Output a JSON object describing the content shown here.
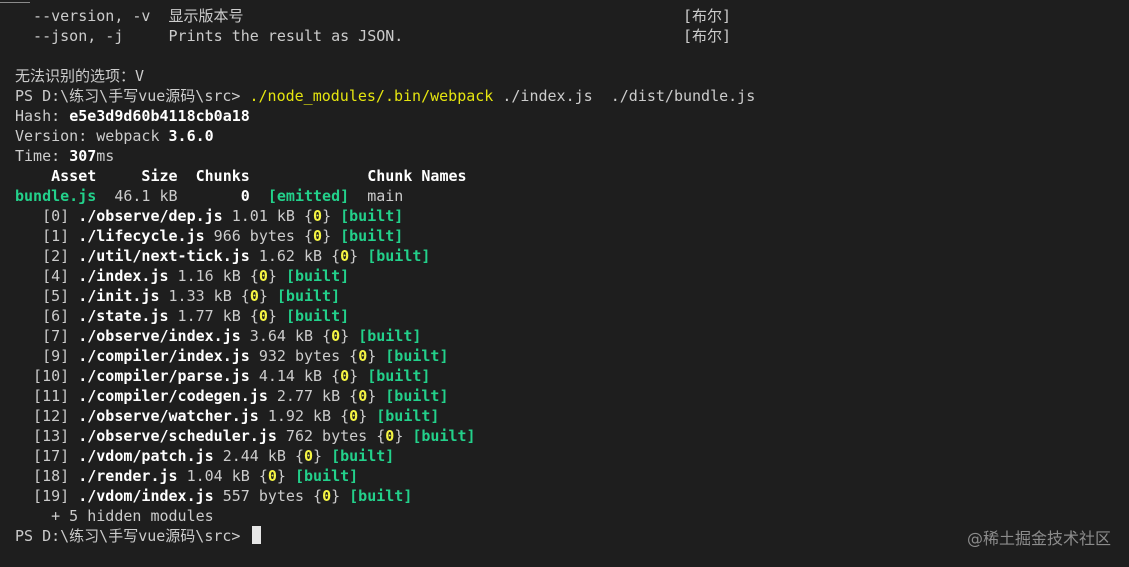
{
  "help": [
    {
      "text": "  --version, -v  显示版本号",
      "type": "[布尔]"
    },
    {
      "text": "  --json, -j     Prints the result as JSON.",
      "type": "[布尔]"
    }
  ],
  "error_line": "无法识别的选项：V",
  "prompt": "PS D:\\练习\\手写vue源码\\src>",
  "command": {
    "bin": "./node_modules/.bin/webpack",
    "args": " ./index.js  ./dist/bundle.js"
  },
  "hash": {
    "label": "Hash: ",
    "value": "e5e3d9d60b4118cb0a18"
  },
  "version": {
    "label": "Version: webpack ",
    "value": "3.6.0"
  },
  "time": {
    "label": "Time: ",
    "value": "307",
    "unit": "ms"
  },
  "asset_table": {
    "header": "    Asset     Size  Chunks             Chunk Names",
    "row": {
      "asset": "bundle.js",
      "size": "  46.1 kB",
      "chunks": "       0",
      "status": "  [emitted]",
      "name": "  main"
    }
  },
  "modules": [
    {
      "index": "   [0] ",
      "path": "./observe/dep.js",
      "size": " 1.01 kB ",
      "chunk": "0",
      "status": "[built]"
    },
    {
      "index": "   [1] ",
      "path": "./lifecycle.js",
      "size": " 966 bytes ",
      "chunk": "0",
      "status": "[built]"
    },
    {
      "index": "   [2] ",
      "path": "./util/next-tick.js",
      "size": " 1.62 kB ",
      "chunk": "0",
      "status": "[built]"
    },
    {
      "index": "   [4] ",
      "path": "./index.js",
      "size": " 1.16 kB ",
      "chunk": "0",
      "status": "[built]"
    },
    {
      "index": "   [5] ",
      "path": "./init.js",
      "size": " 1.33 kB ",
      "chunk": "0",
      "status": "[built]"
    },
    {
      "index": "   [6] ",
      "path": "./state.js",
      "size": " 1.77 kB ",
      "chunk": "0",
      "status": "[built]"
    },
    {
      "index": "   [7] ",
      "path": "./observe/index.js",
      "size": " 3.64 kB ",
      "chunk": "0",
      "status": "[built]"
    },
    {
      "index": "   [9] ",
      "path": "./compiler/index.js",
      "size": " 932 bytes ",
      "chunk": "0",
      "status": "[built]"
    },
    {
      "index": "  [10] ",
      "path": "./compiler/parse.js",
      "size": " 4.14 kB ",
      "chunk": "0",
      "status": "[built]"
    },
    {
      "index": "  [11] ",
      "path": "./compiler/codegen.js",
      "size": " 2.77 kB ",
      "chunk": "0",
      "status": "[built]"
    },
    {
      "index": "  [12] ",
      "path": "./observe/watcher.js",
      "size": " 1.92 kB ",
      "chunk": "0",
      "status": "[built]"
    },
    {
      "index": "  [13] ",
      "path": "./observe/scheduler.js",
      "size": " 762 bytes ",
      "chunk": "0",
      "status": "[built]"
    },
    {
      "index": "  [17] ",
      "path": "./vdom/patch.js",
      "size": " 2.44 kB ",
      "chunk": "0",
      "status": "[built]"
    },
    {
      "index": "  [18] ",
      "path": "./render.js",
      "size": " 1.04 kB ",
      "chunk": "0",
      "status": "[built]"
    },
    {
      "index": "  [19] ",
      "path": "./vdom/index.js",
      "size": " 557 bytes ",
      "chunk": "0",
      "status": "[built]"
    }
  ],
  "hidden_modules": "    + 5 hidden modules",
  "final_prompt": "PS D:\\练习\\手写vue源码\\src>",
  "watermark": "@稀土掘金技术社区",
  "colors": {
    "background": "#1e1e1e",
    "text": "#cccccc",
    "command": "#e5e510",
    "green": "#23d18b"
  }
}
